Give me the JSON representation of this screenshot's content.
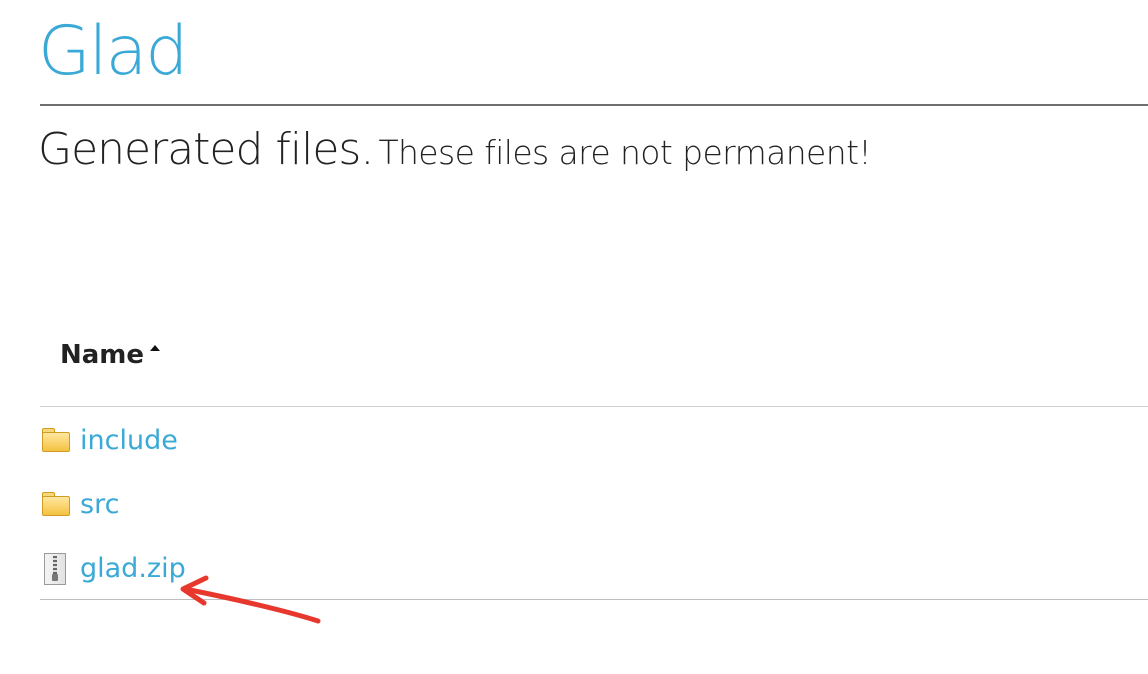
{
  "header": {
    "title": "Glad"
  },
  "subtitle": {
    "main": "Generated files.",
    "note": "These files are not permanent!"
  },
  "table": {
    "column_name": "Name",
    "sort_direction": "ascending",
    "rows": [
      {
        "icon": "folder-icon",
        "label": "include"
      },
      {
        "icon": "folder-icon",
        "label": "src"
      },
      {
        "icon": "zip-file-icon",
        "label": "glad.zip"
      }
    ]
  },
  "colors": {
    "accent": "#3aa9d6",
    "annotation_arrow": "#e8372c"
  }
}
